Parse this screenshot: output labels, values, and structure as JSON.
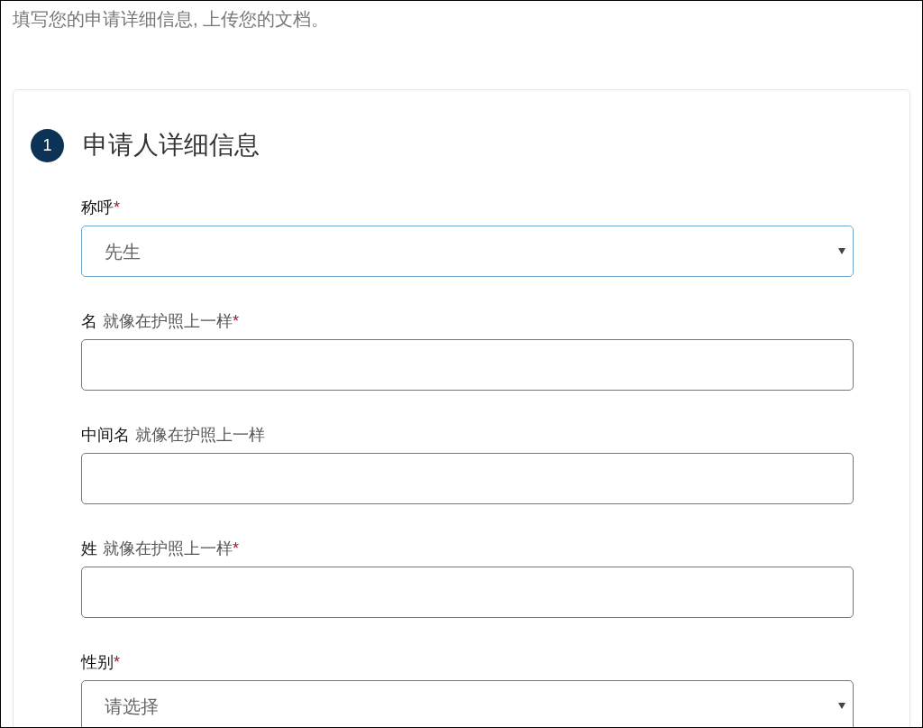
{
  "intro": "填写您的申请详细信息, 上传您的文档。",
  "section": {
    "number": "1",
    "title": "申请人详细信息"
  },
  "fields": [
    {
      "kind": "select",
      "label": "称呼",
      "required_mark": "*",
      "value": "先生",
      "focused": true
    },
    {
      "kind": "text",
      "label": "名",
      "hint": "就像在护照上一样",
      "required_mark": "*",
      "focused": false
    },
    {
      "kind": "text",
      "label": "中间名",
      "hint": "就像在护照上一样",
      "focused": false
    },
    {
      "kind": "text",
      "label": "姓",
      "hint": "就像在护照上一样",
      "required_mark": "*",
      "focused": false
    },
    {
      "kind": "select",
      "label": "性别",
      "required_mark": "*",
      "value": "请选择",
      "focused": false
    }
  ]
}
